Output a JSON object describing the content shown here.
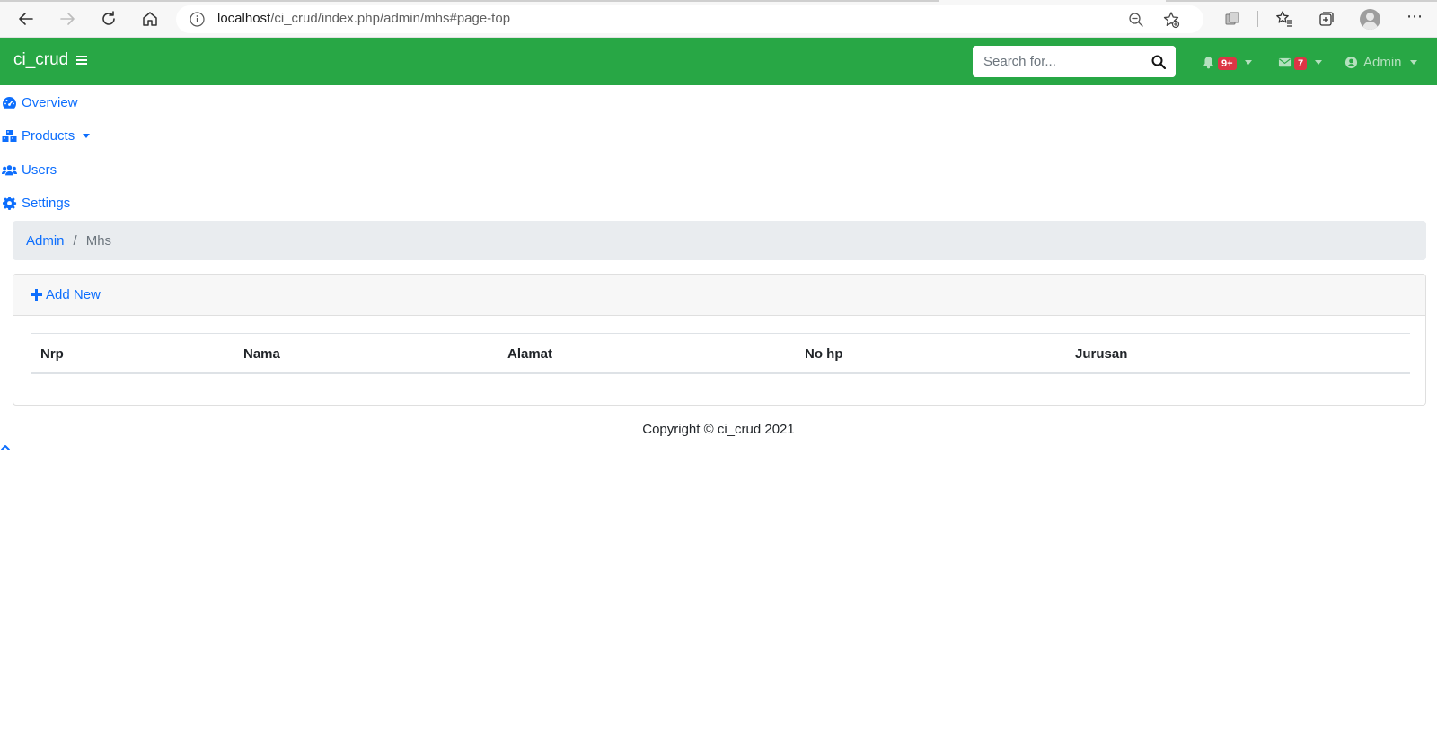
{
  "browser": {
    "url_host": "localhost",
    "url_path": "/ci_crud/index.php/admin/mhs#page-top"
  },
  "navbar": {
    "brand": "ci_crud",
    "search_placeholder": "Search for...",
    "alerts_badge": "9+",
    "messages_badge": "7",
    "user_label": "Admin"
  },
  "sidebar": {
    "items": [
      {
        "label": "Overview",
        "icon": "tachometer-icon"
      },
      {
        "label": "Products",
        "icon": "cubes-icon"
      },
      {
        "label": "Users",
        "icon": "users-icon"
      },
      {
        "label": "Settings",
        "icon": "cog-icon"
      }
    ]
  },
  "breadcrumb": {
    "parent": "Admin",
    "separator": "/",
    "current": "Mhs"
  },
  "card": {
    "add_new_label": "Add New",
    "columns": [
      "Nrp",
      "Nama",
      "Alamat",
      "No hp",
      "Jurusan"
    ]
  },
  "footer": {
    "copyright": "Copyright © ci_crud 2021"
  },
  "colors": {
    "navbar_bg": "#28a745",
    "link": "#0d6efd",
    "badge": "#dc3545",
    "breadcrumb_bg": "#e9ecef"
  }
}
